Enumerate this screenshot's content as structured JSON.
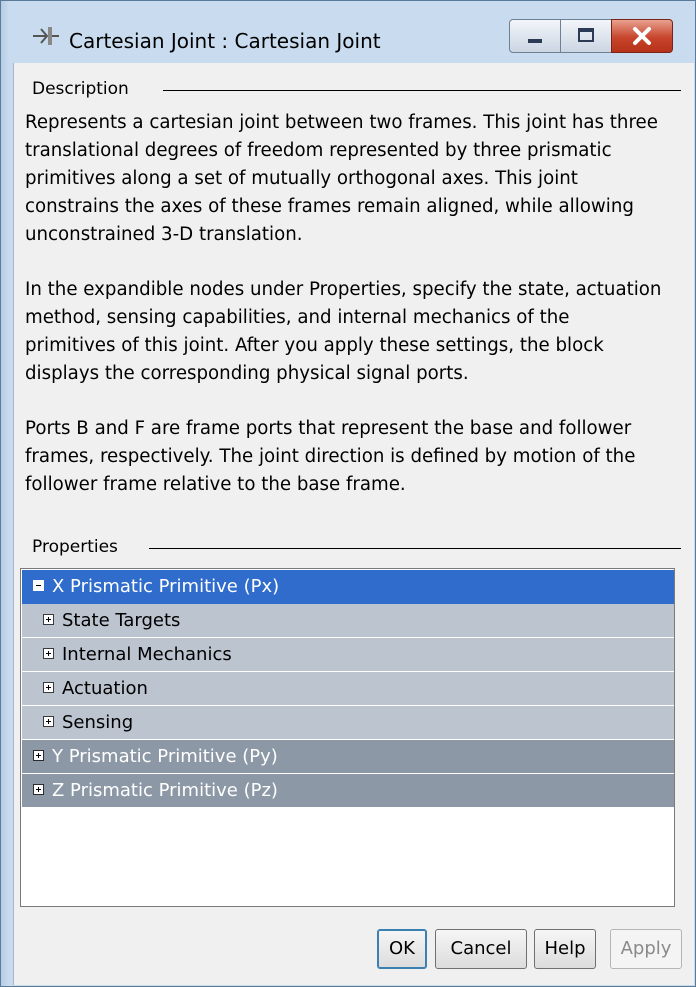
{
  "window": {
    "title": "Cartesian Joint : Cartesian  Joint"
  },
  "description": {
    "legend": "Description",
    "paragraphs": [
      "Represents a cartesian joint between two frames. This joint has three translational degrees of freedom represented by three prismatic primitives along a set of mutually orthogonal axes. This joint constrains the axes of these frames remain aligned, while allowing unconstrained 3-D translation.",
      "In the expandible nodes under Properties, specify the state, actuation method, sensing capabilities, and internal mechanics of the primitives of this joint. After you apply these settings, the block displays the corresponding physical signal ports.",
      "Ports B and F are frame ports that represent the base and follower frames, respectively. The joint direction is defined by motion of the follower frame relative to the base frame."
    ]
  },
  "properties": {
    "legend": "Properties",
    "rows": [
      {
        "label": "X Prismatic Primitive (Px)",
        "expanded": true
      },
      {
        "label": "State Targets",
        "expanded": false
      },
      {
        "label": "Internal Mechanics",
        "expanded": false
      },
      {
        "label": "Actuation",
        "expanded": false
      },
      {
        "label": "Sensing",
        "expanded": false
      },
      {
        "label": "Y Prismatic Primitive (Py)",
        "expanded": false
      },
      {
        "label": "Z Prismatic Primitive (Pz)",
        "expanded": false
      }
    ]
  },
  "buttons": {
    "ok": "OK",
    "cancel": "Cancel",
    "help": "Help",
    "apply": "Apply"
  },
  "colors": {
    "selection": "#2f6ccc",
    "child_row": "#bcc4cf",
    "top_row": "#8d98a6",
    "close_button": "#c7452c"
  }
}
